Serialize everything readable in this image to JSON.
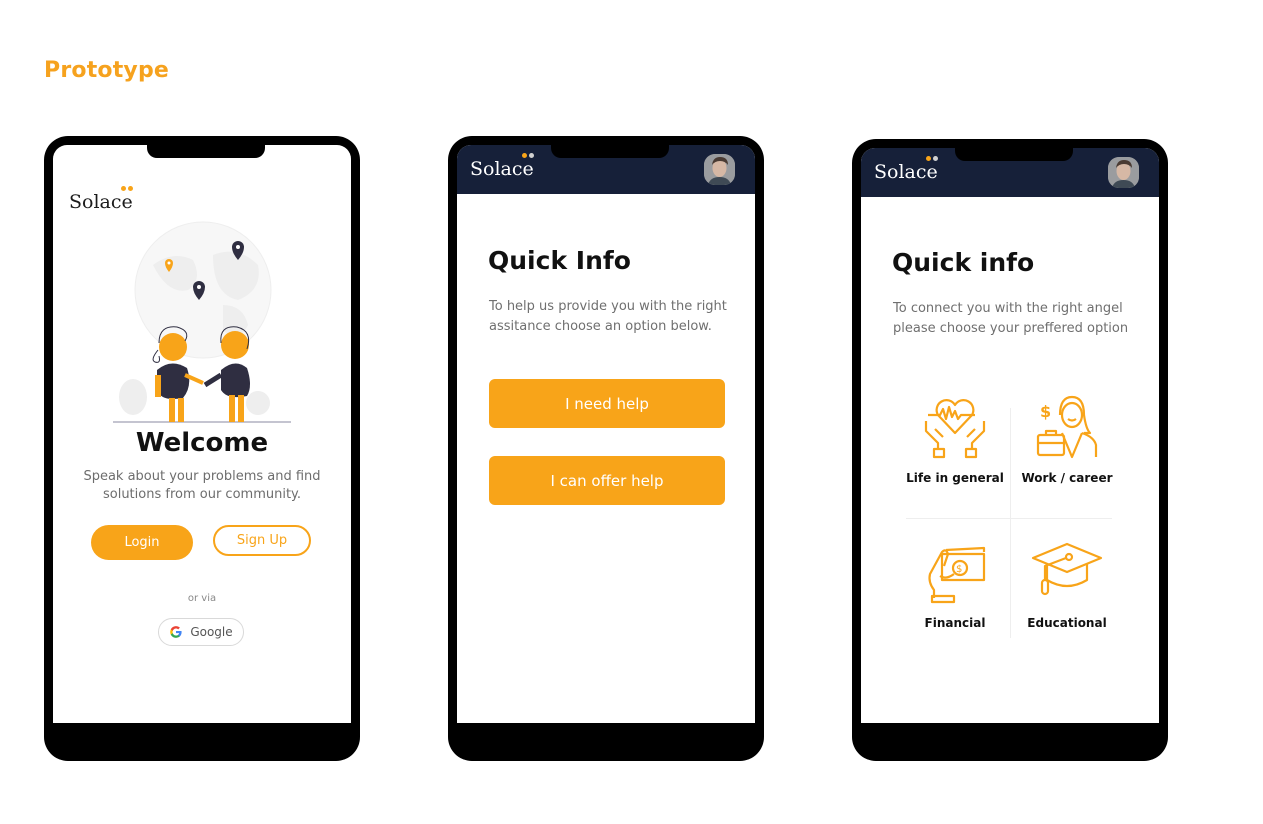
{
  "page": {
    "title": "Prototype"
  },
  "colors": {
    "accent": "#f8a419",
    "header": "#162039",
    "title": "#f6a21e"
  },
  "brand": {
    "name": "Solace"
  },
  "screen1": {
    "heading": "Welcome",
    "subtitle": "Speak about your problems and find solutions from our community.",
    "login_label": "Login",
    "signup_label": "Sign Up",
    "or_via": "or via",
    "google_label": "Google"
  },
  "screen2": {
    "title": "Quick Info",
    "description": "To help us provide you with the right assitance choose an option below.",
    "buttons": [
      {
        "label": "I need help"
      },
      {
        "label": "I can offer help"
      }
    ]
  },
  "screen3": {
    "title": "Quick info",
    "description": "To connect you with the right angel please choose your preffered option",
    "categories": [
      {
        "label": "Life in general",
        "icon": "heart-hands-icon"
      },
      {
        "label": "Work / career",
        "icon": "businesswoman-icon"
      },
      {
        "label": "Financial",
        "icon": "money-hand-icon"
      },
      {
        "label": "Educational",
        "icon": "graduation-cap-icon"
      }
    ]
  }
}
